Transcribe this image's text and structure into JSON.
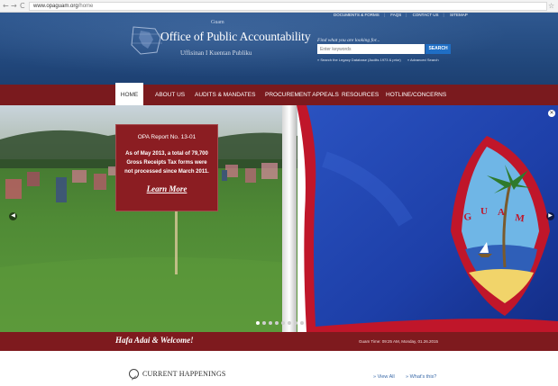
{
  "browser": {
    "back": "←",
    "forward": "→",
    "reload": "C",
    "url_domain": "www.opaguam.org",
    "url_path": "/home",
    "star": "☆"
  },
  "header": {
    "guam": "Guam",
    "title": "Office of Public Accountability",
    "subtitle": "Uffisinan I Kuentan Publiku",
    "top_links": [
      "DOCUMENTS & FORMS",
      "FAQS",
      "CONTACT US",
      "SITEMAP"
    ],
    "find_label": "Find what you are looking for...",
    "search_placeholder": "Enter keywords",
    "search_button": "SEARCH",
    "search_audit_db": "» Search the Legacy Database (Audits 1973 & prior)",
    "advanced_search": "» Advanced Search"
  },
  "nav": {
    "items": [
      "HOME",
      "ABOUT US",
      "AUDITS & MANDATES",
      "PROCUREMENT APPEALS",
      "RESOURCES",
      "HOTLINE/CONCERNS"
    ]
  },
  "hero": {
    "report_title": "OPA Report No. 13-01",
    "report_body": "As of May 2013, a total of 79,700 Gross Receipts Tax forms were not processed since March 2011.",
    "learn_more": "Learn More",
    "flag_text": "GUAM",
    "slide_count": 8,
    "active_slide": 0
  },
  "welcome": {
    "text": "Hafa Adai & Welcome!",
    "guam_time": "Guam Time: 09:25 AM, Monday, 01.26.2015"
  },
  "happenings": {
    "title": "CURRENT HAPPENINGS",
    "view_all": "» View All",
    "whats_this": "» What's this?"
  },
  "colors": {
    "header_blue": "#21477b",
    "nav_maroon": "#7a1a1e",
    "report_red": "#8b1d22",
    "search_blue": "#1f6ec4",
    "flag_blue": "#1d3fa8",
    "flag_red": "#c0162a"
  },
  "icons": {
    "pen": "pen-icon",
    "close": "close-icon",
    "prev": "chevron-left-icon",
    "next": "chevron-right-icon"
  }
}
